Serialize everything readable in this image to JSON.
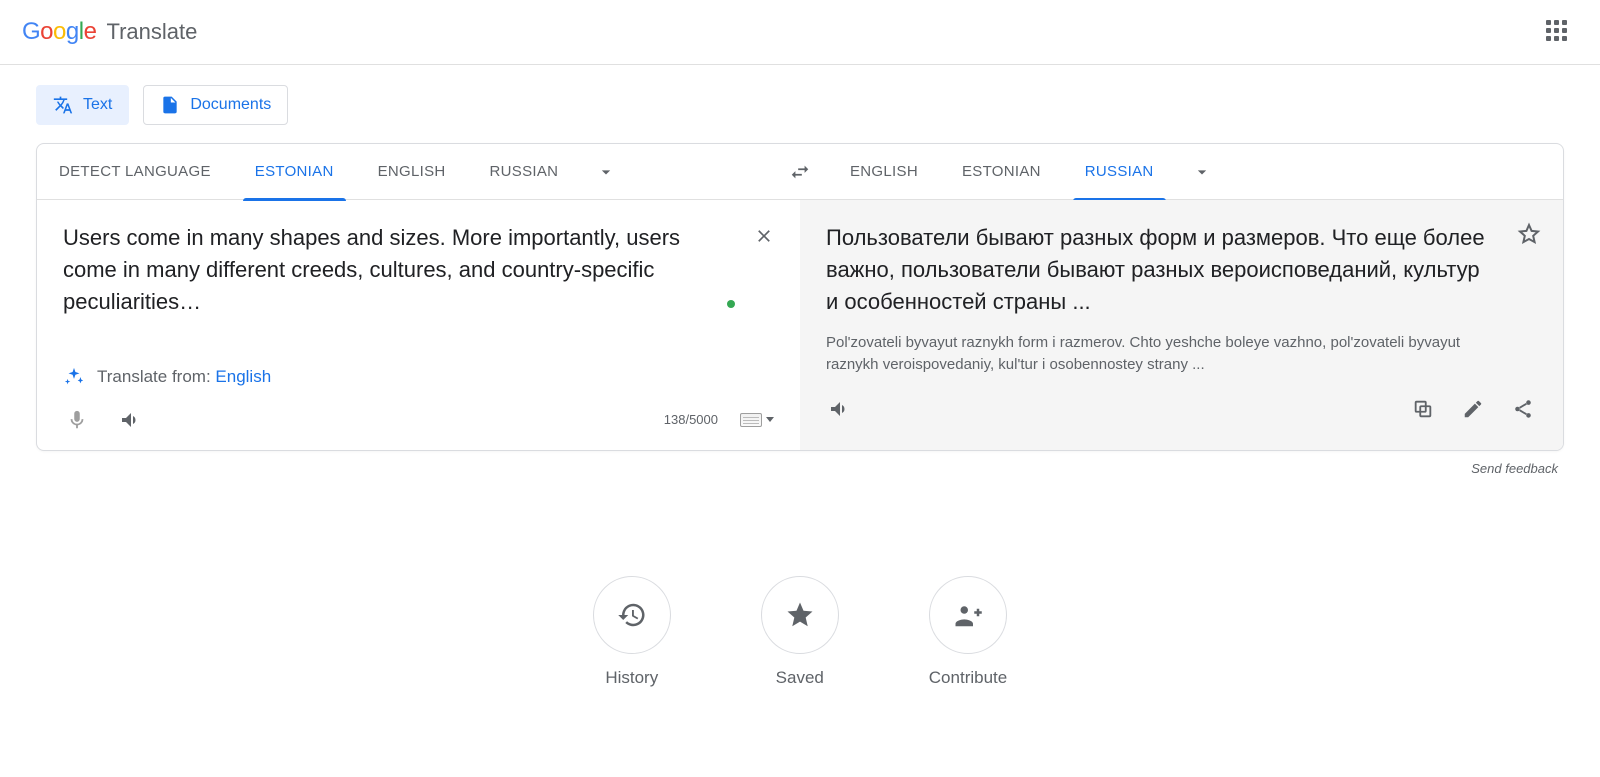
{
  "header": {
    "product": "Translate"
  },
  "modes": {
    "text": "Text",
    "documents": "Documents"
  },
  "source_langs": [
    "DETECT LANGUAGE",
    "ESTONIAN",
    "ENGLISH",
    "RUSSIAN"
  ],
  "source_active_index": 1,
  "target_langs": [
    "ENGLISH",
    "ESTONIAN",
    "RUSSIAN"
  ],
  "target_active_index": 2,
  "source_text": "Users come in many shapes and sizes. More importantly, users come in many different creeds, cultures, and country-specific peculiarities…",
  "translate_from_prefix": "Translate from: ",
  "translate_from_lang": "English",
  "char_count": "138/5000",
  "target_text": "Пользователи бывают разных форм и размеров. Что еще более важно, пользователи бывают разных вероисповеданий, культур и особенностей страны ...",
  "transliteration": "Pol'zovateli byvayut raznykh form i razmerov. Chto yeshche boleye vazhno, pol'zovateli byvayut raznykh veroispovedaniy, kul'tur i osobennostey strany ...",
  "feedback": "Send feedback",
  "bottom_actions": {
    "history": "History",
    "saved": "Saved",
    "contribute": "Contribute"
  }
}
